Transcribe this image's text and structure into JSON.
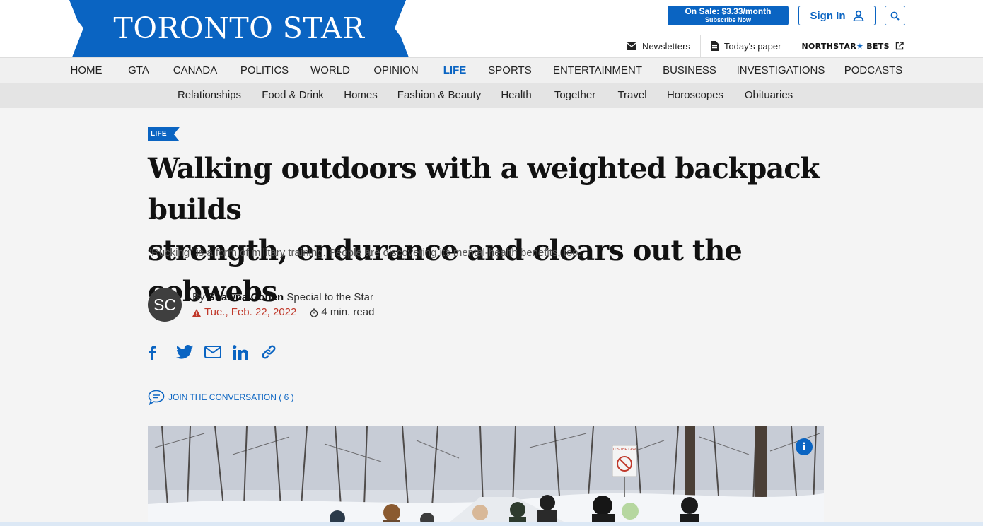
{
  "header": {
    "logo_text": "TORONTO STAR",
    "sale": {
      "line1": "On Sale: $3.33/month",
      "line2": "Subscribe Now"
    },
    "signin_label": "Sign In",
    "utility": {
      "newsletters": "Newsletters",
      "todays_paper": "Today's paper",
      "northstar_a": "NORTHSTAR",
      "northstar_star": "★",
      "northstar_b": "BETS"
    }
  },
  "nav": {
    "main": [
      "HOME",
      "GTA",
      "CANADA",
      "POLITICS",
      "WORLD",
      "OPINION",
      "LIFE",
      "SPORTS",
      "ENTERTAINMENT",
      "BUSINESS",
      "INVESTIGATIONS",
      "PODCASTS"
    ],
    "active": "LIFE",
    "sub": [
      "Relationships",
      "Food & Drink",
      "Homes",
      "Fashion & Beauty",
      "Health",
      "Together",
      "Travel",
      "Horoscopes",
      "Obituaries"
    ]
  },
  "article": {
    "section_tag": "LIFE",
    "headline_line1": "Walking outdoors with a weighted backpack builds",
    "headline_line2": "strength, endurance and clears out the cobwebs",
    "dek": "“Rucking” is a form of military training. People are discovering its mental-health benefits, too.",
    "avatar_initials": "SC",
    "by": "By",
    "author": "Shawna Cohen",
    "author_role": "Special to the Star",
    "date": "Tue., Feb. 22, 2022",
    "read_time": "4 min. read",
    "conversation_label": "JOIN THE CONVERSATION ( 6 )",
    "photo_sign": "IT'S THE LAW",
    "info_label": "i"
  },
  "colors": {
    "brand_blue": "#0a64c2",
    "date_red": "#c0392b"
  },
  "icons": [
    "envelope-icon",
    "newspaper-icon",
    "external-link-icon",
    "user-icon",
    "search-icon",
    "facebook-icon",
    "twitter-icon",
    "email-icon",
    "linkedin-icon",
    "link-icon",
    "chat-icon",
    "warning-icon",
    "stopwatch-icon",
    "info-icon"
  ]
}
